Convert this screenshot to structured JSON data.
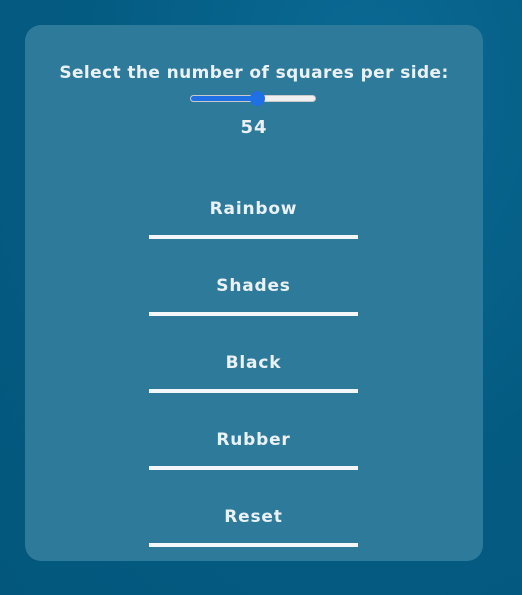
{
  "grid_settings": {
    "prompt": "Select the number of squares per side:",
    "slider": {
      "min": 1,
      "max": 100,
      "value": 54,
      "accent_color": "#1f6fe5"
    },
    "value_display": "54"
  },
  "buttons": [
    {
      "label": "Rainbow"
    },
    {
      "label": "Shades"
    },
    {
      "label": "Black"
    },
    {
      "label": "Rubber"
    },
    {
      "label": "Reset"
    }
  ],
  "colors": {
    "background": "#045c83",
    "panel": "#2e7a9b",
    "text": "#eaf1f5"
  }
}
